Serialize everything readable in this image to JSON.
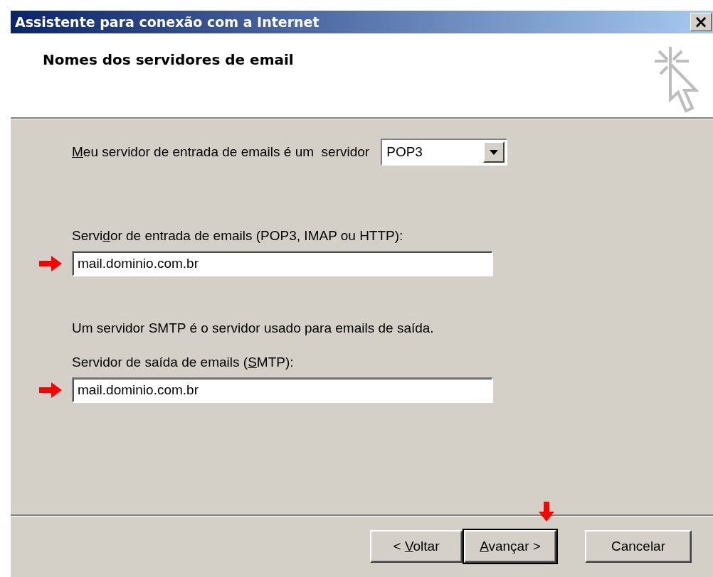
{
  "window": {
    "title": "Assistente para conexão com a Internet",
    "close_glyph": "×"
  },
  "header": {
    "title": "Nomes dos servidores de email"
  },
  "server_type": {
    "label": {
      "key": "M",
      "post": "eu servidor de entrada de emails é um  servidor"
    },
    "value": "POP3"
  },
  "incoming": {
    "label": {
      "pre": "Servi",
      "key": "d",
      "post": "or de entrada de emails (POP3, IMAP ou HTTP):"
    },
    "value": "mail.dominio.com.br",
    "marked": true
  },
  "smtp_note": "Um servidor SMTP é o servidor usado para emails de saída.",
  "outgoing": {
    "label": {
      "pre": "Servidor de saída de emails (",
      "key": "S",
      "post": "MTP):"
    },
    "value": "mail.dominio.com.br",
    "marked": true
  },
  "buttons": [
    {
      "label": {
        "pre": "< ",
        "key": "V",
        "post": "oltar"
      },
      "default": false,
      "marked": false
    },
    {
      "label": {
        "key": "A",
        "post": "vançar >"
      },
      "default": true,
      "marked": true
    },
    {
      "label": {
        "pre": "Cancelar"
      },
      "default": false,
      "marked": false
    }
  ]
}
